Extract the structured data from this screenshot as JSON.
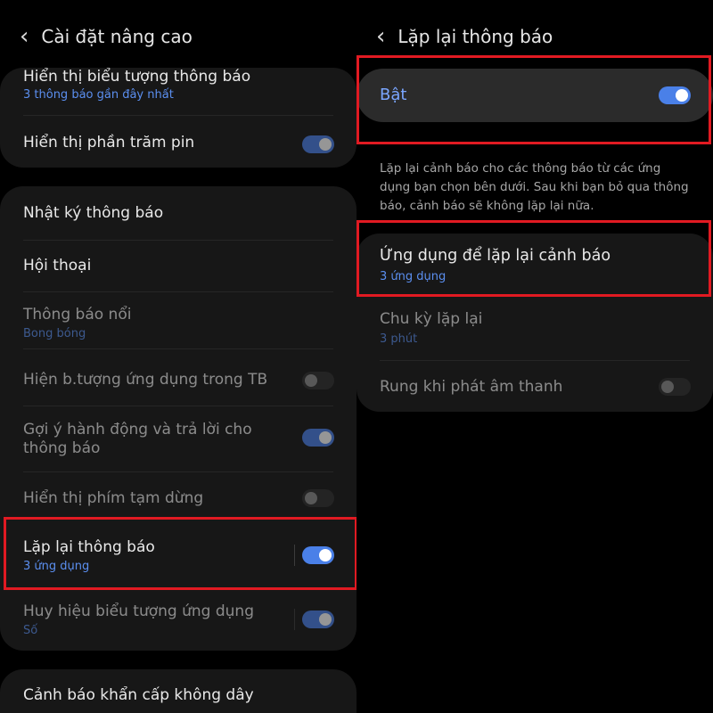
{
  "left": {
    "header": {
      "title": "Cài đặt nâng cao"
    },
    "group1": {
      "items": [
        {
          "label": "Hiển thị biểu tượng thông báo",
          "sub": "3 thông báo gần đây nhất"
        },
        {
          "label": "Hiển thị phần trăm pin",
          "toggle": "on"
        }
      ]
    },
    "group2": {
      "items": [
        {
          "label": "Nhật ký thông báo"
        },
        {
          "label": "Hội thoại"
        },
        {
          "label": "Thông báo nổi",
          "sub": "Bong bóng"
        },
        {
          "label": "Hiện b.tượng ứng dụng trong TB",
          "toggle": "off"
        },
        {
          "label": "Gợi ý hành động và trả lời cho thông báo",
          "toggle": "on"
        },
        {
          "label": "Hiển thị phím tạm dừng",
          "toggle": "off"
        },
        {
          "label": "Lặp lại thông báo",
          "sub": "3 ứng dụng",
          "toggle": "on"
        },
        {
          "label": "Huy hiệu biểu tượng ứng dụng",
          "sub": "Số",
          "toggle": "on"
        }
      ]
    },
    "group3": {
      "items": [
        {
          "label": "Cảnh báo khẩn cấp không dây"
        }
      ]
    }
  },
  "right": {
    "header": {
      "title": "Lặp lại thông báo"
    },
    "master": {
      "label": "Bật",
      "toggle": "on"
    },
    "description": "Lặp lại cảnh báo cho các thông báo từ các ứng dụng bạn chọn bên dưới. Sau khi bạn bỏ qua thông báo, cảnh báo sẽ không lặp lại nữa.",
    "items": [
      {
        "label": "Ứng dụng để lặp lại cảnh báo",
        "sub": "3 ứng dụng"
      },
      {
        "label": "Chu kỳ lặp lại",
        "sub": "3 phút"
      },
      {
        "label": "Rung khi phát âm thanh",
        "toggle": "off"
      }
    ]
  },
  "colors": {
    "highlight": "#e11a22",
    "accent": "#4a80e8",
    "subtext": "#5b8ff0"
  }
}
